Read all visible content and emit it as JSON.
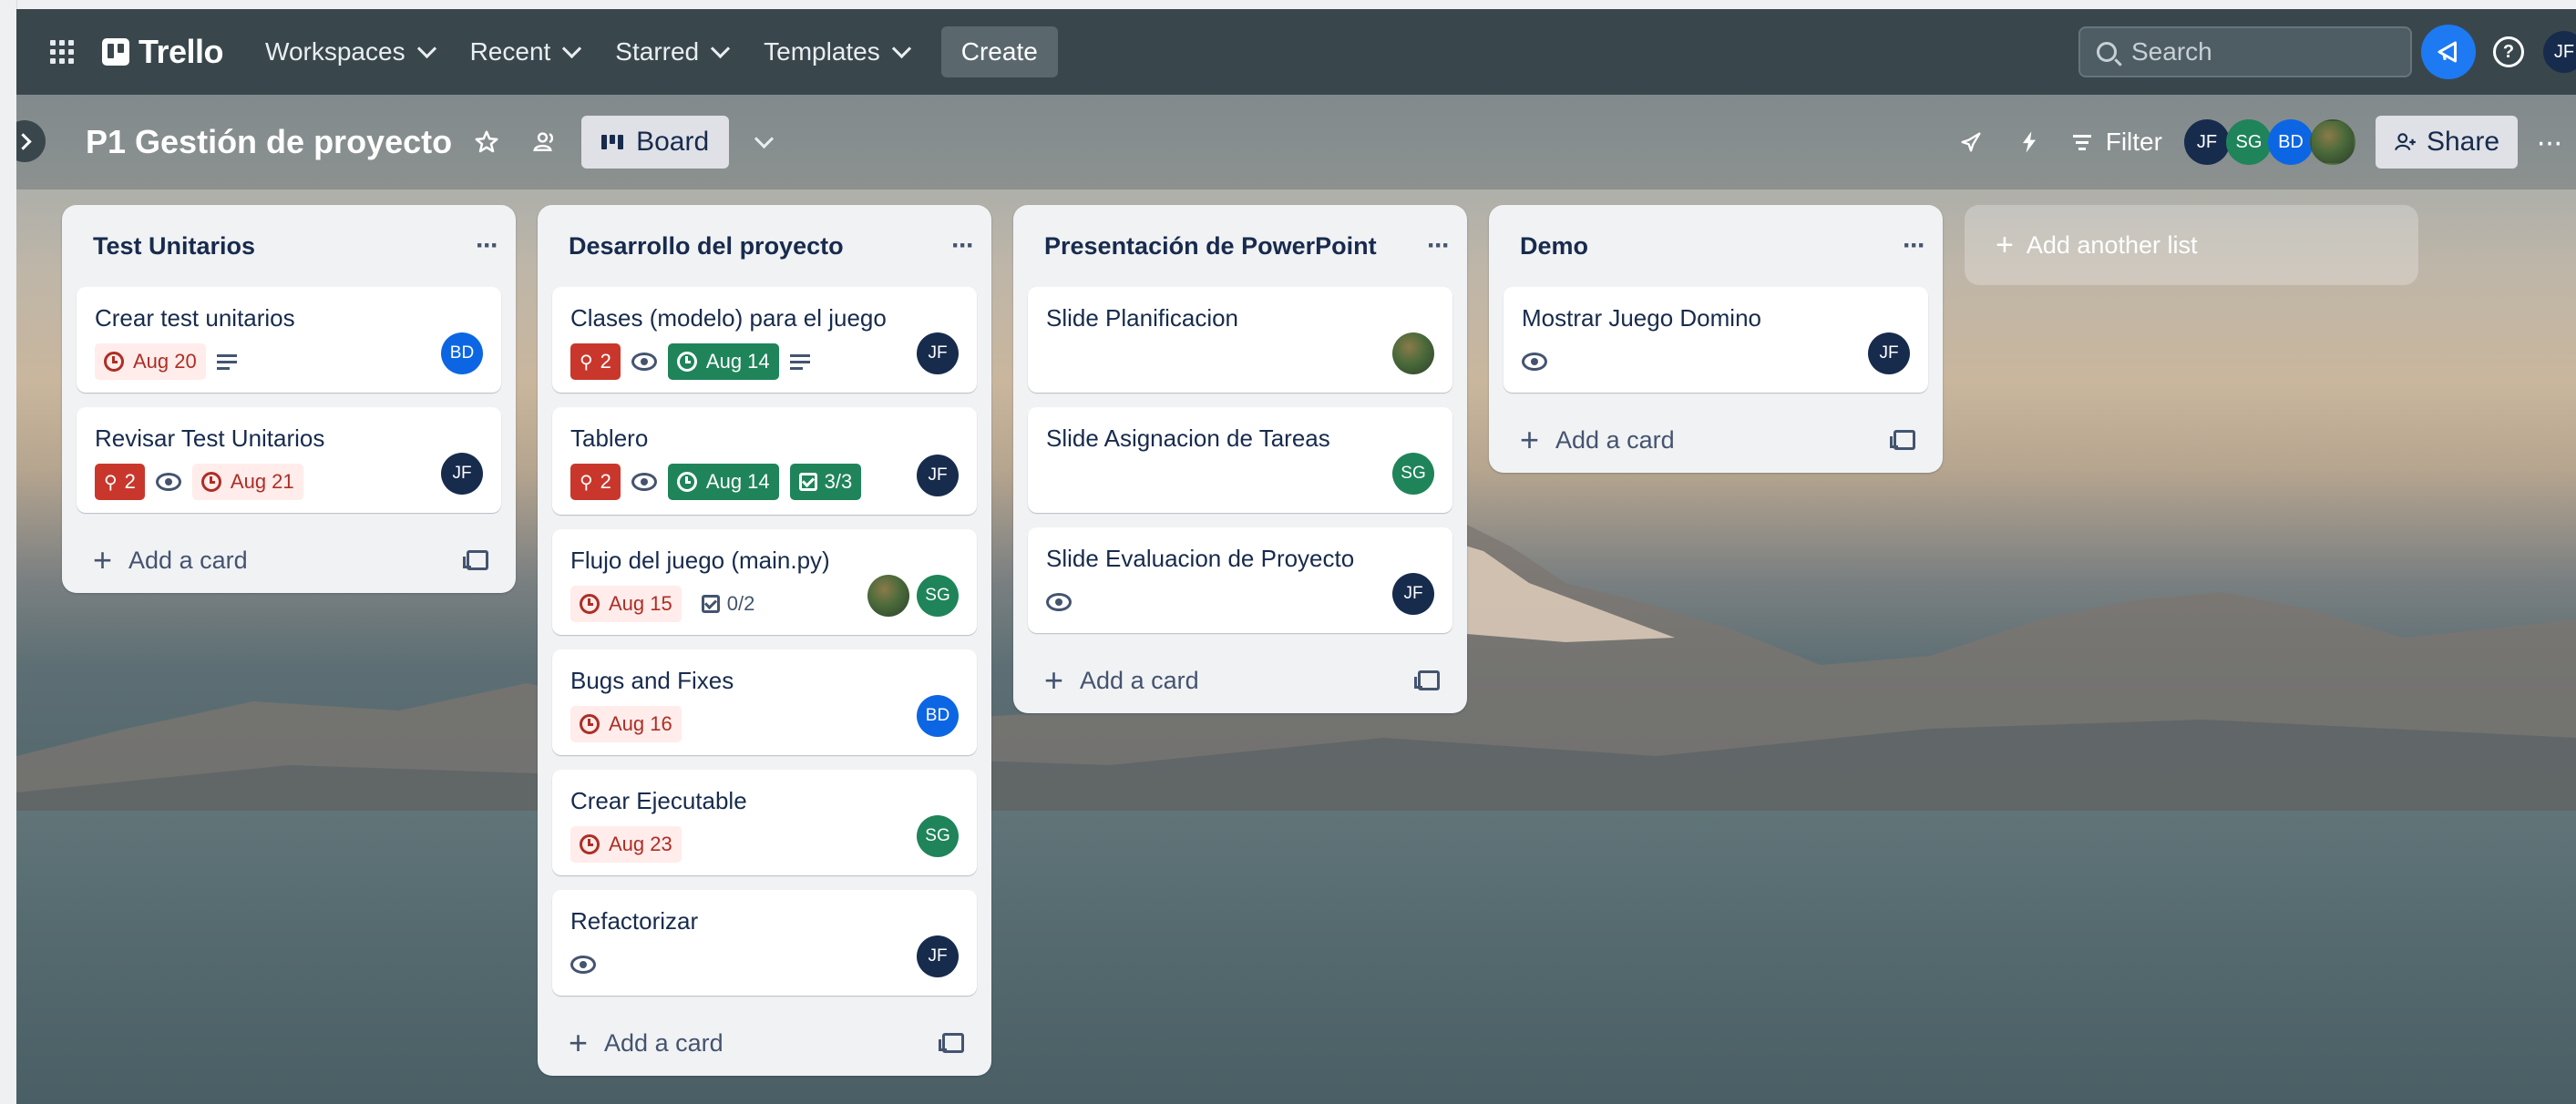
{
  "topnav": {
    "logo": "Trello",
    "items": [
      "Workspaces",
      "Recent",
      "Starred",
      "Templates"
    ],
    "create_label": "Create",
    "search_placeholder": "Search",
    "user_initials": "JF"
  },
  "board": {
    "title": "P1 Gestión de proyecto",
    "view_label": "Board",
    "filter_label": "Filter",
    "share_label": "Share",
    "members": [
      {
        "initials": "JF",
        "color": "#172b4d"
      },
      {
        "initials": "SG",
        "color": "#1f845a"
      },
      {
        "initials": "BD",
        "color": "#0c66e4"
      },
      {
        "initials": "",
        "color": "photo"
      }
    ]
  },
  "lists": [
    {
      "title": "Test Unitarios",
      "cards": [
        {
          "title": "Crear test unitarios",
          "due": "Aug 20",
          "description": true,
          "avatar": "BD"
        },
        {
          "title": "Revisar Test Unitarios",
          "pins": "2",
          "watch": true,
          "due": "Aug 21",
          "avatar": "JF"
        }
      ],
      "add_label": "Add a card"
    },
    {
      "title": "Desarrollo del proyecto",
      "cards": [
        {
          "title": "Clases (modelo) para el juego",
          "pins": "2",
          "watch": true,
          "due_done": "Aug 14",
          "description": true,
          "avatar": "JF"
        },
        {
          "title": "Tablero",
          "pins": "2",
          "watch": true,
          "due_done": "Aug 14",
          "checklist_done": "3/3",
          "avatar": "JF"
        },
        {
          "title": "Flujo del juego (main.py)",
          "due": "Aug 15",
          "checklist": "0/2",
          "avatars": [
            "photo",
            "SG"
          ]
        },
        {
          "title": "Bugs and Fixes",
          "due": "Aug 16",
          "avatar": "BD"
        },
        {
          "title": "Crear Ejecutable",
          "due": "Aug 23",
          "avatar": "SG"
        },
        {
          "title": "Refactorizar",
          "watch": true,
          "avatar": "JF"
        }
      ],
      "add_label": "Add a card"
    },
    {
      "title": "Presentación de PowerPoint",
      "cards": [
        {
          "title": "Slide Planificacion",
          "avatar": "photo"
        },
        {
          "title": "Slide Asignacion de Tareas",
          "avatar": "SG"
        },
        {
          "title": "Slide Evaluacion de Proyecto",
          "watch": true,
          "avatar": "JF"
        }
      ],
      "add_label": "Add a card"
    },
    {
      "title": "Demo",
      "cards": [
        {
          "title": "Mostrar Juego Domino",
          "watch": true,
          "avatar": "JF"
        }
      ],
      "add_label": "Add a card"
    }
  ],
  "add_list_label": "Add another list",
  "colors": {
    "nav": "#39474d",
    "due_overdue_bg": "#ffeceb",
    "due_overdue_text": "#ae2e24",
    "done_green": "#1f845a",
    "pin_red": "#c9372c"
  }
}
